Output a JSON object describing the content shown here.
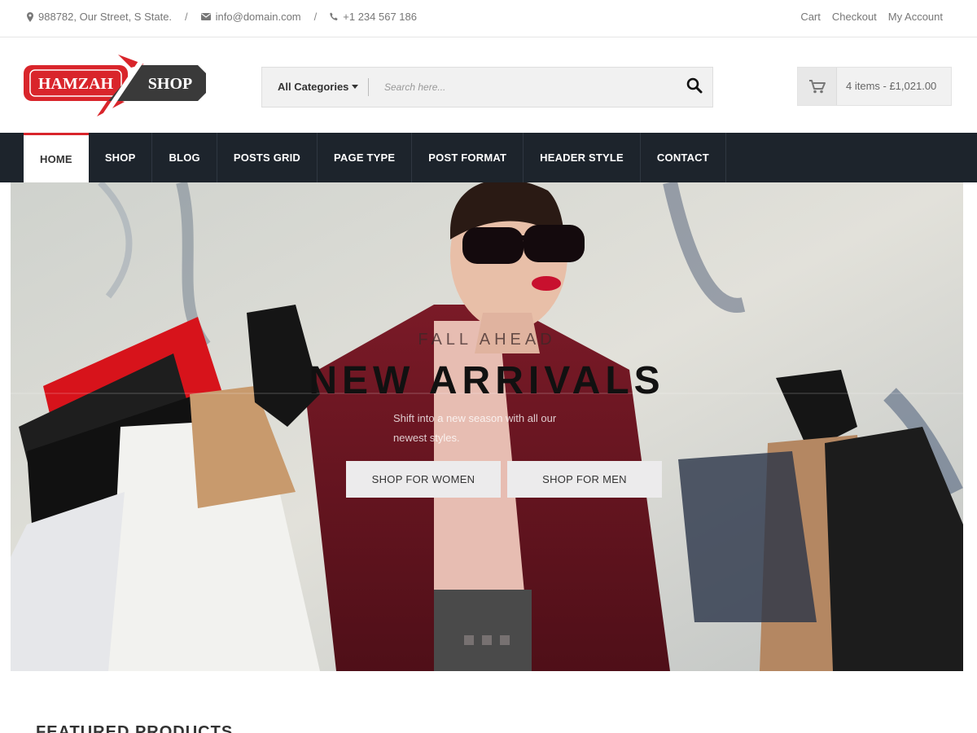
{
  "topbar": {
    "address": "988782, Our Street, S State.",
    "email": "info@domain.com",
    "phone": "+1 234 567 186",
    "separator": "/",
    "links": [
      "Cart",
      "Checkout",
      "My Account"
    ]
  },
  "logo": {
    "left_text": "HAMZAH",
    "right_text": "SHOP"
  },
  "search": {
    "category_label": "All Categories",
    "placeholder": "Search here..."
  },
  "cart": {
    "summary": "4 items - £1,021.00"
  },
  "nav": {
    "items": [
      "HOME",
      "SHOP",
      "BLOG",
      "POSTS GRID",
      "PAGE TYPE",
      "POST FORMAT",
      "HEADER STYLE",
      "CONTACT"
    ],
    "active": "HOME"
  },
  "hero": {
    "overline": "Fall Ahead",
    "title": "NEW ARRIVALS",
    "subtitle": "Shift into a new season with all our newest styles.",
    "buttons": {
      "women": "SHOP FOR WOMEN",
      "men": "SHOP FOR MEN"
    },
    "slides": 3,
    "active_slide": 1
  },
  "section": {
    "featured_title": "FEATURED PRODUCTS"
  },
  "colors": {
    "accent": "#d9252b",
    "nav_bg": "#1d242c",
    "coat": "#6d1622"
  },
  "icons": [
    "map-marker-icon",
    "envelope-icon",
    "phone-icon",
    "caret-down-icon",
    "search-icon",
    "cart-icon"
  ]
}
